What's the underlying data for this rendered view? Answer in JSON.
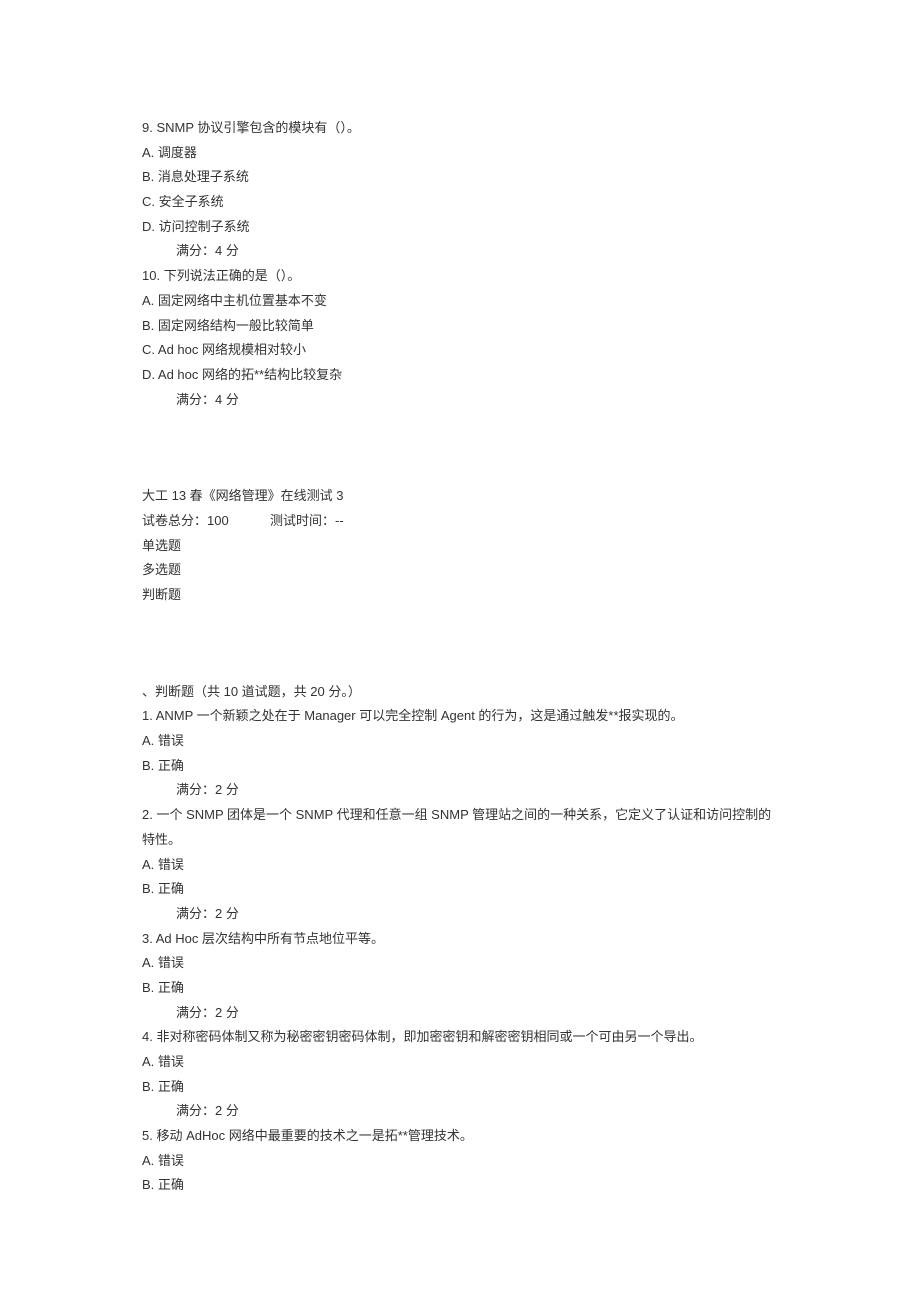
{
  "mc_questions": [
    {
      "num": "9.",
      "stem": "SNMP 协议引擎包含的模块有（）。",
      "options": [
        {
          "label": "A.",
          "text": "调度器"
        },
        {
          "label": "B.",
          "text": "消息处理子系统"
        },
        {
          "label": "C.",
          "text": "安全子系统"
        },
        {
          "label": "D.",
          "text": "访问控制子系统"
        }
      ],
      "score": "满分：4 分"
    },
    {
      "num": "10.",
      "stem": "下列说法正确的是（）。",
      "options": [
        {
          "label": "A.",
          "text": "固定网络中主机位置基本不变"
        },
        {
          "label": "B.",
          "text": "固定网络结构一般比较简单"
        },
        {
          "label": "C.",
          "text": "Ad hoc 网络规模相对较小"
        },
        {
          "label": "D.",
          "text": "Ad hoc 网络的拓**结构比较复杂"
        }
      ],
      "score": "满分：4 分"
    }
  ],
  "header": {
    "title": "大工 13 春《网络管理》在线测试 3",
    "score_label": "试卷总分：",
    "score_value": "100",
    "time_label": "测试时间：",
    "time_value": "--",
    "types": [
      "单选题",
      "多选题",
      "判断题"
    ]
  },
  "tf_section": {
    "header": "、判断题（共 10 道试题，共 20 分。）",
    "questions": [
      {
        "num": "1.",
        "stem": "ANMP 一个新颖之处在于 Manager 可以完全控制 Agent 的行为，这是通过触发**报实现的。",
        "options": [
          {
            "label": "A.",
            "text": "错误"
          },
          {
            "label": "B.",
            "text": "正确"
          }
        ],
        "score": "满分：2 分"
      },
      {
        "num": "2.",
        "stem": "一个 SNMP 团体是一个 SNMP 代理和任意一组 SNMP 管理站之间的一种关系，它定义了认证和访问控制的特性。",
        "options": [
          {
            "label": "A.",
            "text": "错误"
          },
          {
            "label": "B.",
            "text": "正确"
          }
        ],
        "score": "满分：2 分"
      },
      {
        "num": "3.",
        "stem": "Ad Hoc 层次结构中所有节点地位平等。",
        "options": [
          {
            "label": "A.",
            "text": "错误"
          },
          {
            "label": "B.",
            "text": "正确"
          }
        ],
        "score": "满分：2 分"
      },
      {
        "num": "4.",
        "stem": "非对称密码体制又称为秘密密钥密码体制，即加密密钥和解密密钥相同或一个可由另一个导出。",
        "options": [
          {
            "label": "A.",
            "text": "错误"
          },
          {
            "label": "B.",
            "text": "正确"
          }
        ],
        "score": "满分：2 分"
      },
      {
        "num": "5.",
        "stem": "移动 AdHoc 网络中最重要的技术之一是拓**管理技术。",
        "options": [
          {
            "label": "A.",
            "text": "错误"
          },
          {
            "label": "B.",
            "text": "正确"
          }
        ],
        "score": ""
      }
    ]
  }
}
